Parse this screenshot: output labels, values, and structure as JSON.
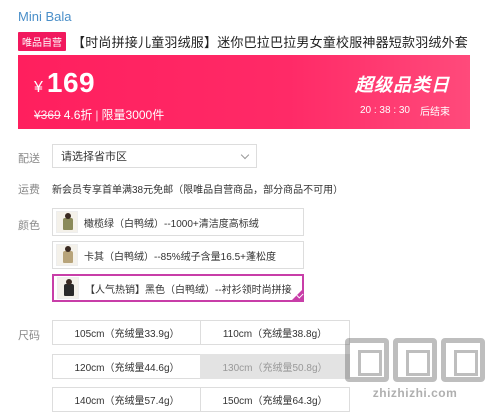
{
  "brand": "Mini Bala",
  "product": {
    "tag": "唯品自营",
    "title": "【时尚拼接儿童羽绒服】迷你巴拉巴拉男女童校服神器短款羽绒外套"
  },
  "price_banner": {
    "currency": "¥",
    "price": "169",
    "original_price": "¥369",
    "discount": "4.6折",
    "divider": "|",
    "limit": "限量3000件",
    "event_name": "超级品类日",
    "countdown": "20 : 38 : 30",
    "countdown_label": "后结束",
    "colors": {
      "banner": "#ff2a67",
      "tag": "#f1185d"
    }
  },
  "delivery": {
    "label": "配送",
    "select_value": "请选择省市区"
  },
  "freight": {
    "label": "运费",
    "text": "新会员专享首单满38元免邮（限唯品自营商品，部分商品不可用）"
  },
  "color_section": {
    "label": "颜色",
    "options": [
      {
        "name": "橄榄绿（白鸭绒）--1000+清洁度高标绒",
        "selected": false
      },
      {
        "name": "卡其（白鸭绒）--85%绒子含量16.5+蓬松度",
        "selected": false
      },
      {
        "name": "【人气热销】黑色（白鸭绒）--衬衫领时尚拼接",
        "selected": true
      }
    ],
    "selected_color": "#c83ea8"
  },
  "size_section": {
    "label": "尺码",
    "options": [
      {
        "name": "105cm（充绒量33.9g）",
        "disabled": false
      },
      {
        "name": "110cm（充绒量38.8g）",
        "disabled": false
      },
      {
        "name": "120cm（充绒量44.6g）",
        "disabled": false
      },
      {
        "name": "130cm（充绒量50.8g）",
        "disabled": true
      },
      {
        "name": "140cm（充绒量57.4g）",
        "disabled": false
      },
      {
        "name": "150cm（充绒量64.3g）",
        "disabled": false
      }
    ]
  },
  "watermark": {
    "text": "zhizhizhi.com"
  }
}
